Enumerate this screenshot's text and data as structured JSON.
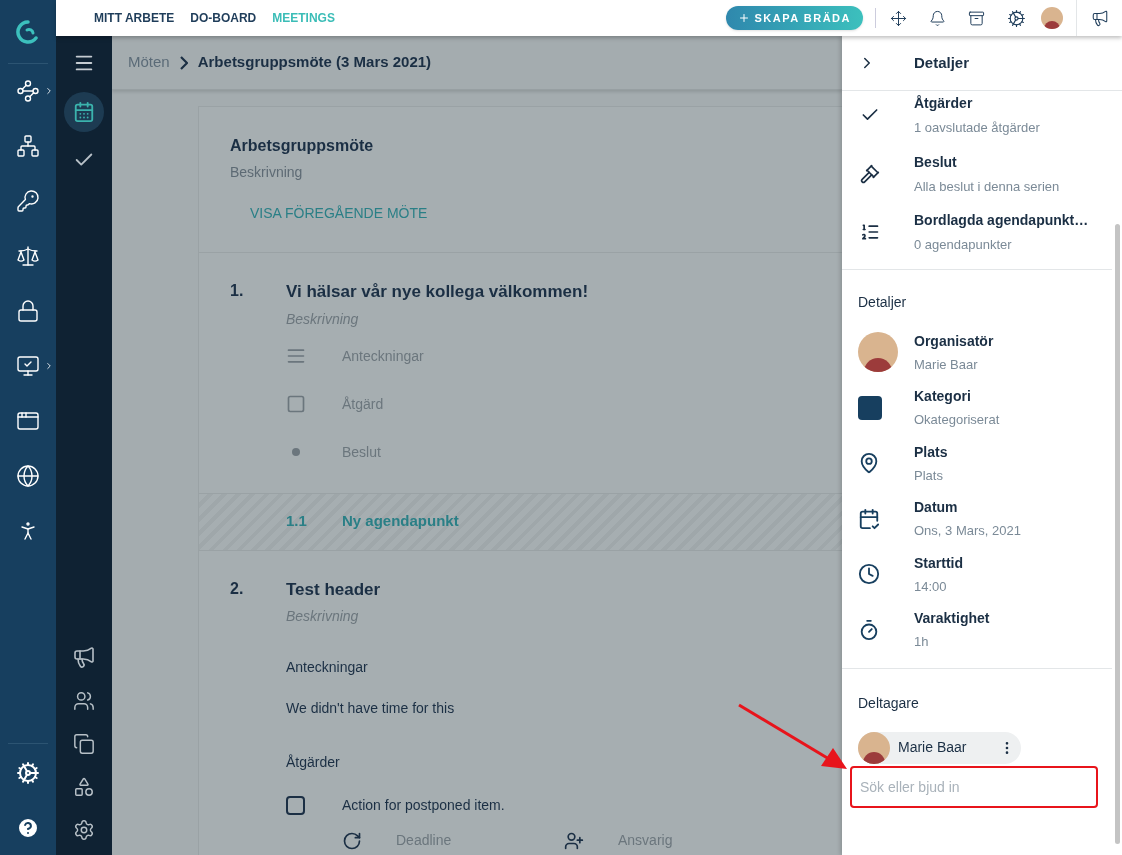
{
  "nav_tabs": [
    {
      "label": "MITT ARBETE",
      "selected": false
    },
    {
      "label": "DO-BOARD",
      "selected": false
    },
    {
      "label": "MEETINGS",
      "selected": true
    }
  ],
  "create_button": {
    "label": "SKAPA BRÄDA"
  },
  "module_menu": [
    {
      "kind": "meetings",
      "selected": true
    },
    {
      "kind": "tasks",
      "selected": false
    }
  ],
  "breadcrumb": [
    "Möten",
    "Arbetsgruppsmöte (3 Mars 2021)"
  ],
  "meeting": {
    "title": "Arbetsgruppsmöte",
    "description": "Beskrivning",
    "link": "VISA FÖREGÅENDE MÖTE"
  },
  "agenda": [
    {
      "kind": "item",
      "number": "1.",
      "title": "Vi hälsar vår nye kollega välkommen!",
      "description": "Beskrivning",
      "entries": [
        {
          "kind": "notes",
          "label": "Anteckningar"
        },
        {
          "kind": "action",
          "label": "Åtgärd"
        },
        {
          "kind": "decision",
          "label": "Beslut"
        }
      ]
    },
    {
      "kind": "new_subitem",
      "number": "1.1",
      "title": "Ny agendapunkt"
    },
    {
      "kind": "item",
      "number": "2.",
      "title": "Test header",
      "description": "Beskrivning",
      "notes_heading": "Anteckningar",
      "notes": "We didn't have time for this",
      "actions_heading": "Åtgärder",
      "actions": [
        {
          "label": "Action for postponed item.",
          "checked": false,
          "deadline": "Deadline",
          "owner": "Ansvarig"
        }
      ]
    }
  ],
  "panel": {
    "title": "Detaljer",
    "links": [
      {
        "kind": "actions",
        "title": "Åtgärder",
        "subtitle": "1 oavslutade åtgärder"
      },
      {
        "kind": "decisions",
        "title": "Beslut",
        "subtitle": "Alla beslut i denna serien"
      },
      {
        "kind": "tabled",
        "title": "Bordlagda agendapunkt…",
        "subtitle": "0 agendapunkter"
      }
    ],
    "details_heading": "Detaljer",
    "details": [
      {
        "kind": "organizer",
        "title": "Organisatör",
        "value": "Marie Baar"
      },
      {
        "kind": "category",
        "title": "Kategori",
        "value": "Okategoriserat"
      },
      {
        "kind": "place",
        "title": "Plats",
        "value": "Plats"
      },
      {
        "kind": "date",
        "title": "Datum",
        "value": "Ons, 3 Mars, 2021"
      },
      {
        "kind": "time",
        "title": "Starttid",
        "value": "14:00"
      },
      {
        "kind": "duration",
        "title": "Varaktighet",
        "value": "1h"
      }
    ],
    "participants_heading": "Deltagare",
    "participants": [
      {
        "name": "Marie Baar"
      }
    ],
    "invite": {
      "placeholder": "Sök eller bjud in"
    }
  }
}
